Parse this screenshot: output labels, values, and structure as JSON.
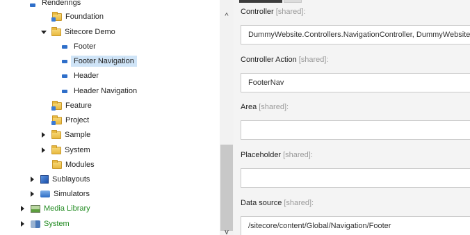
{
  "tree": {
    "partial_top_label": "Renderings",
    "items": [
      {
        "label": "Foundation"
      },
      {
        "label": "Sitecore Demo"
      },
      {
        "label": "Footer"
      },
      {
        "label": "Footer Navigation"
      },
      {
        "label": "Header"
      },
      {
        "label": "Header Navigation"
      },
      {
        "label": "Feature"
      },
      {
        "label": "Project"
      },
      {
        "label": "Sample"
      },
      {
        "label": "System"
      },
      {
        "label": "Modules"
      },
      {
        "label": "Sublayouts"
      },
      {
        "label": "Simulators"
      },
      {
        "label": "Media Library"
      },
      {
        "label": "System"
      }
    ],
    "selected_item": "Footer Navigation"
  },
  "scrollbar": {
    "up_glyph": "^",
    "down_glyph": "v"
  },
  "editor": {
    "fields": [
      {
        "label": "Controller",
        "shared": "[shared]:",
        "value": "DummyWebsite.Controllers.NavigationController, DummyWebsite"
      },
      {
        "label": "Controller Action",
        "shared": "[shared]:",
        "value": "FooterNav"
      },
      {
        "label": "Area",
        "shared": "[shared]:",
        "value": ""
      },
      {
        "label": "Placeholder",
        "shared": "[shared]:",
        "value": ""
      },
      {
        "label": "Data source",
        "shared": "[shared]:",
        "value": "/sitecore/content/Global/Navigation/Footer"
      }
    ]
  },
  "colors": {
    "selection_bg": "#cfe4f7",
    "green_text": "#1f8a1f",
    "shared_text": "#9a9a9a"
  }
}
